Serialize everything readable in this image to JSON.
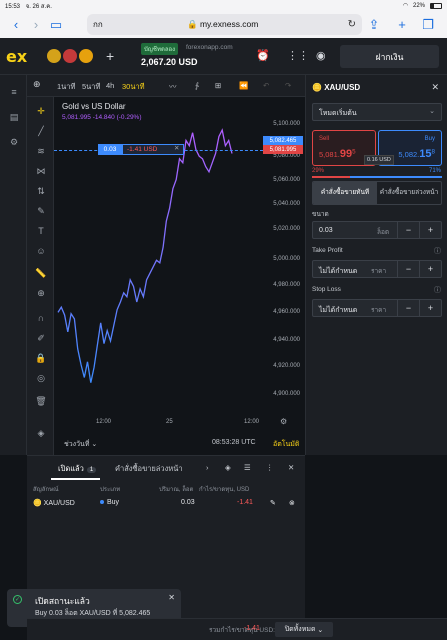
{
  "status_bar": {
    "time": "15:53",
    "date": "จ. 26 ส.ค.",
    "battery": "22%"
  },
  "safari": {
    "tab_text": "กก",
    "host": "my.exness.com",
    "reader_label": "AA"
  },
  "header": {
    "logo": "ex",
    "account_tag": "บัญชีทดลอง",
    "server": "forexonapp.com",
    "balance": "2,067.20 USD",
    "deposit_label": "ฝากเงิน"
  },
  "chart_toolbar": {
    "timeframes": [
      "1นาที",
      "5นาที",
      "4h",
      "30นาที"
    ],
    "active_timeframe": "30นาที"
  },
  "chart": {
    "title": "Gold vs US Dollar",
    "price_line": "5,081.995  -14.840  (-0.29%)",
    "position_qty": "0.03",
    "position_pl": "-1.41 USD",
    "position_close": "✕",
    "ask_tag": "5,082.465",
    "bid_tag": "5,081.995",
    "range_label": "ช่วงวันที่",
    "clock": "08:53:28 UTC",
    "auto_label": "อัตโนมัติ"
  },
  "chart_data": {
    "type": "line",
    "x_ticks": [
      "12:00",
      "25",
      "12:00"
    ],
    "y_ticks": [
      "5,100.000",
      "5,080.000",
      "5,060.000",
      "5,040.000",
      "5,020.000",
      "5,000.000",
      "4,980.000",
      "4,960.000",
      "4,940.000",
      "4,920.000",
      "4,900.000"
    ],
    "ylim": [
      4895,
      5107
    ],
    "series": [
      {
        "values": [
          4960,
          4964,
          4958,
          4945,
          4959,
          4955,
          4932,
          4920,
          4910,
          4922,
          4906,
          4918,
          4935,
          4952,
          4936,
          4946,
          4938,
          4950,
          4962,
          4968,
          4975,
          4972,
          4985,
          4980,
          4968,
          4978,
          4972,
          4985,
          4990,
          4995,
          5000,
          4998,
          5010,
          5030,
          5040,
          5055,
          5062,
          5078,
          5075,
          5092,
          5088,
          5098,
          5085,
          5080,
          5078,
          5072,
          5068,
          5075,
          5082,
          5095,
          5100,
          5088,
          5092,
          5082
        ]
      }
    ],
    "grid": false
  },
  "trade_panel": {
    "symbol": "XAU/USD",
    "mode": "โหมดเริ่มต้น",
    "sell_label": "Sell",
    "sell_price": "5,081",
    "sell_price_big": "99",
    "sell_price_small": "5",
    "buy_label": "Buy",
    "buy_price": "5,082",
    "buy_price_big": "15",
    "buy_price_small": "8",
    "spread": "0.16 USD",
    "sell_ratio": "29%",
    "buy_ratio": "71%",
    "sell_ratio_value": 29,
    "order_tab_market": "คำสั่งซื้อขายทันที",
    "order_tab_pending": "คำสั่งซื้อขายล่วงหน้า",
    "volume_label": "ขนาด",
    "volume": "0.03",
    "volume_unit": "ล็อต",
    "tp_label": "Take Profit",
    "tp_value": "ไม่ได้กำหนด",
    "tp_unit": "ราคา",
    "sl_label": "Stop Loss",
    "sl_value": "ไม่ได้กำหนด",
    "sl_unit": "ราคา"
  },
  "positions": {
    "tab_open": "เปิดแล้ว",
    "tab_open_count": "1",
    "tab_pending": "คำสั่งซื้อขายล่วงหน้า",
    "columns": [
      "สัญลักษณ์",
      "ประเภท",
      "ปริมาณ, ล็อต",
      "กำไร/ขาดทุน, USD"
    ],
    "rows": [
      {
        "symbol": "XAU/USD",
        "type": "Buy",
        "volume": "0.03",
        "pl": "-1.41"
      }
    ]
  },
  "toast": {
    "title": "เปิดสถานะแล้ว",
    "message": "Buy 0.03 ล็อต XAU/USD ที่ 5,082.465"
  },
  "bottom_bar": {
    "pl_label": "รวมกำไร/ขาดทุน USD:",
    "pl_value": "-1.41",
    "close_all": "ปิดทั้งหมด"
  },
  "colors": {
    "accent": "#f7d118",
    "sell": "#e04545",
    "buy": "#3d8bfd",
    "line_start": "#3d8bfd",
    "line_end": "#b15eff"
  }
}
